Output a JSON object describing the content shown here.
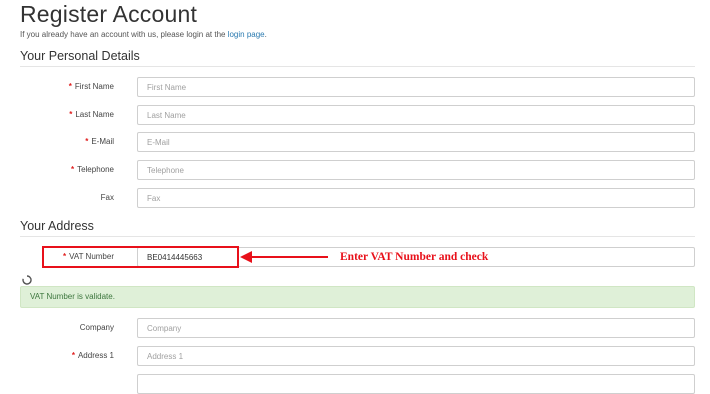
{
  "page": {
    "title": "Register Account",
    "intro_text": "If you already have an account with us, please login at the ",
    "login_link": "login page",
    "intro_suffix": "."
  },
  "personal": {
    "section_title": "Your Personal Details",
    "fields": [
      {
        "label": "First Name",
        "required": true,
        "placeholder": "First Name",
        "value": ""
      },
      {
        "label": "Last Name",
        "required": true,
        "placeholder": "Last Name",
        "value": ""
      },
      {
        "label": "E-Mail",
        "required": true,
        "placeholder": "E-Mail",
        "value": ""
      },
      {
        "label": "Telephone",
        "required": true,
        "placeholder": "Telephone",
        "value": ""
      },
      {
        "label": "Fax",
        "required": false,
        "placeholder": "Fax",
        "value": ""
      }
    ]
  },
  "address": {
    "section_title": "Your Address",
    "vat": {
      "label": "VAT Number",
      "required": true,
      "value": "BE0414445663"
    },
    "vat_status": "VAT Number is validate.",
    "fields": [
      {
        "label": "Company",
        "required": false,
        "placeholder": "Company",
        "value": ""
      },
      {
        "label": "Address 1",
        "required": true,
        "placeholder": "Address 1",
        "value": ""
      }
    ]
  },
  "annotation": {
    "text": "Enter VAT Number and check",
    "color": "#e8101a"
  },
  "colors": {
    "required_star": "#e02020",
    "link": "#2a7ab0",
    "alert_bg": "#dff0d8",
    "alert_text": "#3c763d"
  },
  "icons": {
    "spinner": "loading-spinner-icon",
    "arrow": "red-arrow-left-icon"
  }
}
